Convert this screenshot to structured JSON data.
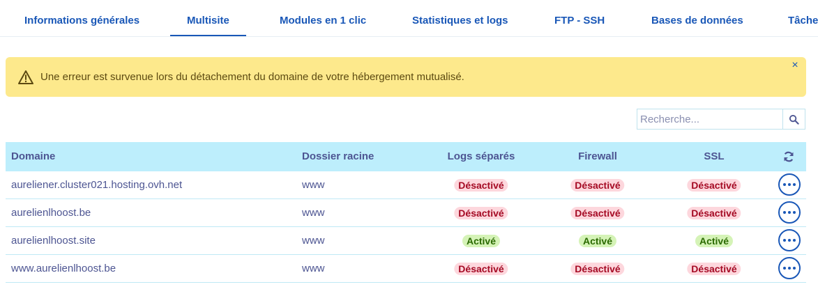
{
  "tabs": [
    "Informations générales",
    "Multisite",
    "Modules en 1 clic",
    "Statistiques et logs",
    "FTP - SSH",
    "Bases de données",
    "Tâches"
  ],
  "active_tab": "Multisite",
  "alert": {
    "message": "Une erreur est survenue lors du détachement du domaine de votre hébergement mutualisé.",
    "close": "×",
    "color": "#fde98c"
  },
  "search": {
    "placeholder": "Recherche..."
  },
  "table": {
    "headers": {
      "domain": "Domaine",
      "root": "Dossier racine",
      "logs": "Logs séparés",
      "firewall": "Firewall",
      "ssl": "SSL"
    },
    "rows": [
      {
        "domain": "aureliener.cluster021.hosting.ovh.net",
        "root": "www",
        "logs": "Désactivé",
        "firewall": "Désactivé",
        "ssl": "Désactivé"
      },
      {
        "domain": "aurelienlhoost.be",
        "root": "www",
        "logs": "Désactivé",
        "firewall": "Désactivé",
        "ssl": "Désactivé"
      },
      {
        "domain": "aurelienlhoost.site",
        "root": "www",
        "logs": "Activé",
        "firewall": "Activé",
        "ssl": "Activé"
      },
      {
        "domain": "www.aurelienlhoost.be",
        "root": "www",
        "logs": "Désactivé",
        "firewall": "Désactivé",
        "ssl": "Désactivé"
      }
    ]
  },
  "colors": {
    "primary": "#1957b7",
    "header_bg": "#bdeefc",
    "off_bg": "#fdd7dd",
    "on_bg": "#d5f3b7"
  },
  "icons": [
    "warning-icon",
    "close-icon",
    "search-icon",
    "refresh-icon",
    "more-actions-icon"
  ]
}
